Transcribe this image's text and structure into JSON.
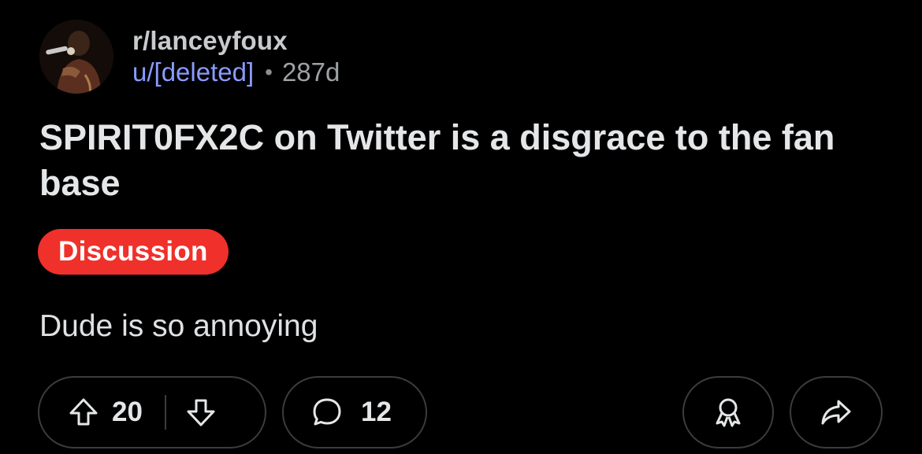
{
  "post": {
    "subreddit": "r/lanceyfoux",
    "author": "u/[deleted]",
    "separator": "•",
    "age": "287d",
    "title": "SPIRIT0FX2C on Twitter is a disgrace to the fan base",
    "flair": "Discussion",
    "body": "Dude is so annoying"
  },
  "actions": {
    "upvote_icon": "arrow-up-outline-icon",
    "score": "20",
    "downvote_icon": "arrow-down-outline-icon",
    "comment_icon": "speech-bubble-icon",
    "comment_count": "12",
    "award_icon": "award-ribbon-icon",
    "share_icon": "share-arrow-icon"
  },
  "colors": {
    "background": "#000000",
    "username": "#8a9bff",
    "flair_bg": "#f0302a",
    "pill_border": "#3a3c3f"
  }
}
